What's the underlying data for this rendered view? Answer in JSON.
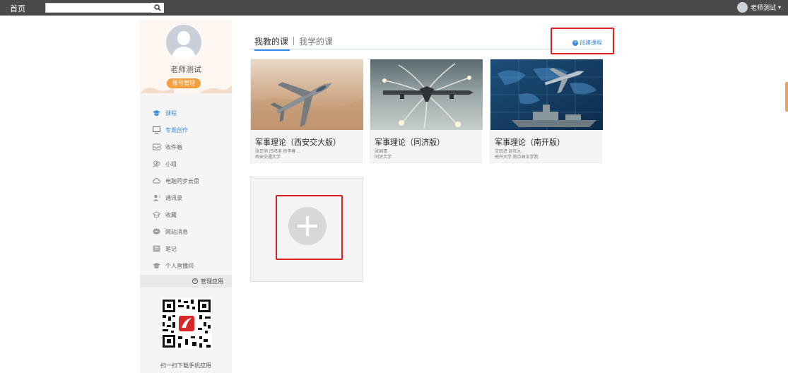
{
  "topbar": {
    "home_label": "首页",
    "search_placeholder": "",
    "user_name": "老师测试",
    "caret": "▾"
  },
  "sidebar": {
    "profile_name": "老师测试",
    "account_button": "账号管理",
    "items": [
      {
        "label": "课程",
        "icon": "graduation-cap-icon",
        "active": true
      },
      {
        "label": "专题创作",
        "icon": "monitor-icon",
        "active": false
      },
      {
        "label": "收件箱",
        "icon": "inbox-icon",
        "active": false
      },
      {
        "label": "小组",
        "icon": "group-icon",
        "active": false
      },
      {
        "label": "电脑同步云盘",
        "icon": "cloud-icon",
        "active": false
      },
      {
        "label": "通讯录",
        "icon": "contacts-icon",
        "active": false
      },
      {
        "label": "收藏",
        "icon": "bookmark-icon",
        "active": false
      },
      {
        "label": "网站消息",
        "icon": "message-icon",
        "active": false
      },
      {
        "label": "笔记",
        "icon": "note-icon",
        "active": false
      },
      {
        "label": "个人直播间",
        "icon": "live-icon",
        "active": false
      }
    ],
    "manage_apps": "管理应用",
    "qr_label": "扫一扫下载手机应用"
  },
  "main": {
    "tabs": [
      "我教的课",
      "我学的课"
    ],
    "create_course": "创建课程",
    "courses": [
      {
        "title": "军事理论（西安交大版）",
        "teachers": "张正明 闫鸿滨 徐李春 ...",
        "school": "西安交通大学",
        "image": "jet-fighter-desert"
      },
      {
        "title": "军事理论（同济版）",
        "teachers": "张国清",
        "school": "同济大学",
        "image": "transport-aircraft-flares"
      },
      {
        "title": "军事理论（南开版）",
        "teachers": "艾跃进 赵欢九",
        "school": "南开大学 南京政治学院",
        "image": "fighter-warship-map"
      }
    ]
  },
  "colors": {
    "accent": "#3a8ee6",
    "account_button": "#f5a040",
    "highlight": "#e02020",
    "topbar": "#4a4a4a"
  }
}
